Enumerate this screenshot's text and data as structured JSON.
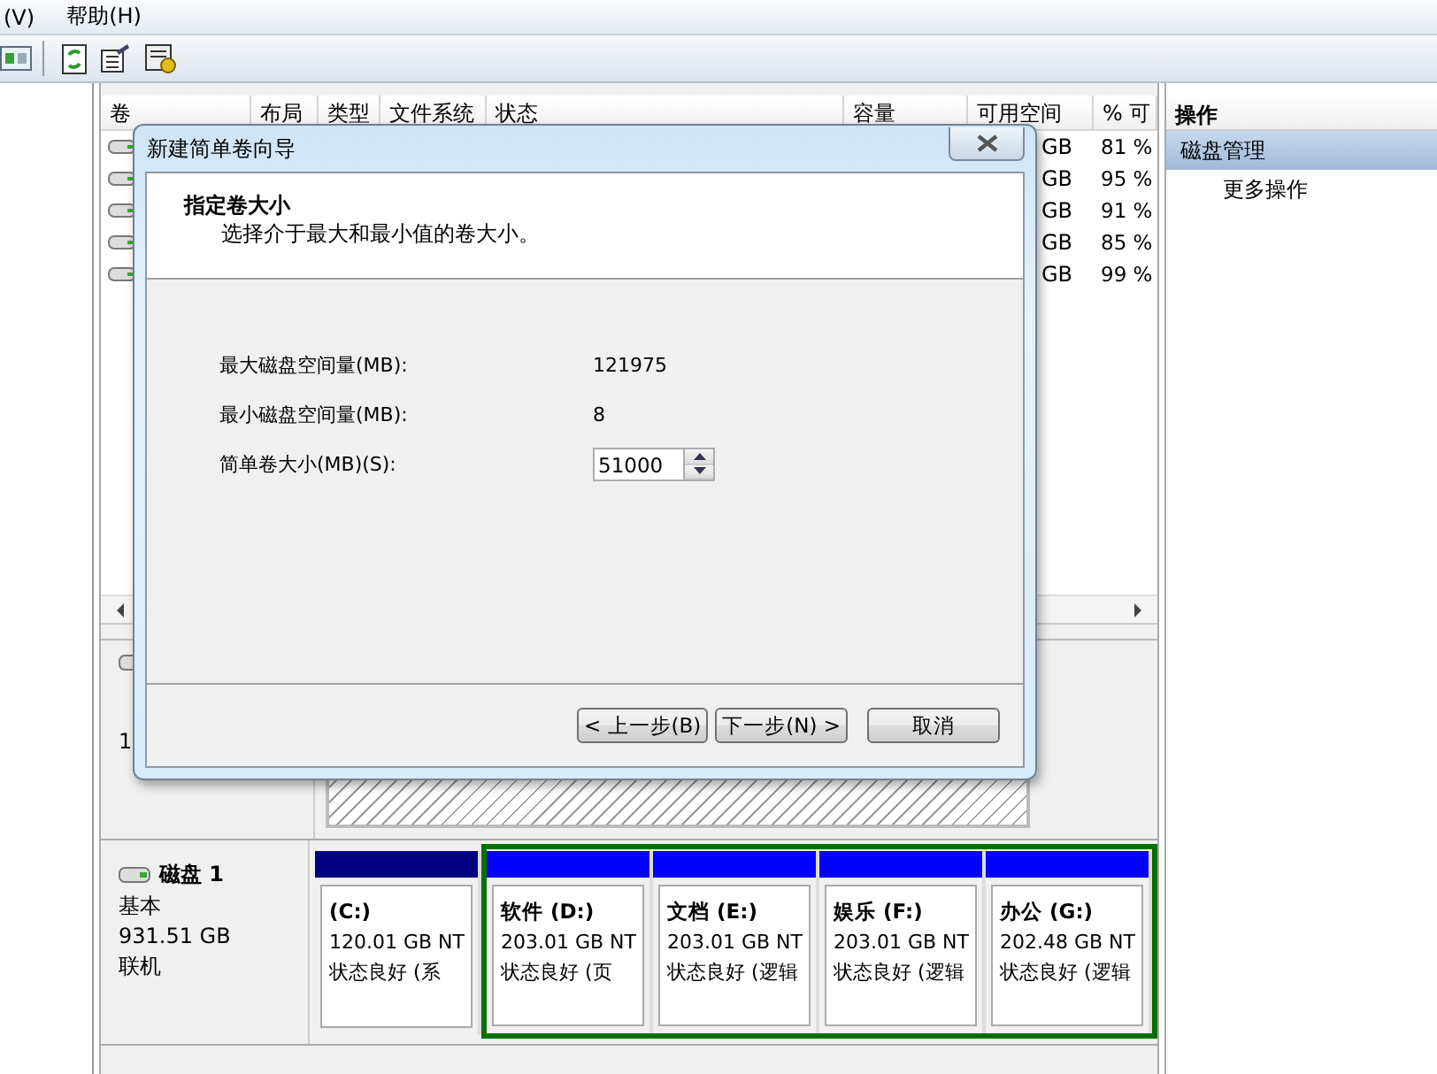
{
  "menu": [
    {
      "label": "(V)"
    },
    {
      "label": "帮助(H)"
    }
  ],
  "volume_table": {
    "columns": [
      "卷",
      "布局",
      "类型",
      "文件系统",
      "状态",
      "容量",
      "可用空间",
      "% 可"
    ],
    "rows": [
      {
        "free": "GB",
        "percent": "81 %"
      },
      {
        "free": "GB",
        "percent": "95 %"
      },
      {
        "free": "GB",
        "percent": "91 %"
      },
      {
        "free": "GB",
        "percent": "85 %"
      },
      {
        "free": "GB",
        "percent": "99 %"
      }
    ]
  },
  "disk0": {
    "lines": [
      "1"
    ]
  },
  "disk1": {
    "name": "磁盘 1",
    "type": "基本",
    "size": "931.51 GB",
    "status": "联机",
    "primary": [
      {
        "name": "(C:)",
        "size": "120.01 GB NT",
        "status": "状态良好 (系",
        "color": "#000080"
      }
    ],
    "extended": {
      "partitions": [
        {
          "name": "软件 (D:)",
          "size": "203.01 GB NT",
          "status": "状态良好 (页",
          "color": "#0000ff"
        },
        {
          "name": "文档 (E:)",
          "size": "203.01 GB NT",
          "status": "状态良好 (逻辑",
          "color": "#0000ff"
        },
        {
          "name": "娱乐 (F:)",
          "size": "203.01 GB NT",
          "status": "状态良好 (逻辑",
          "color": "#0000ff"
        },
        {
          "name": "办公 (G:)",
          "size": "202.48 GB NT",
          "status": "状态良好 (逻辑",
          "color": "#0000ff"
        }
      ]
    }
  },
  "actions": {
    "title": "操作",
    "items": [
      {
        "label": "磁盘管理",
        "kind": "section",
        "selected": true
      },
      {
        "label": "更多操作",
        "kind": "sub",
        "selected": false
      }
    ]
  },
  "dialog": {
    "title": "新建简单卷向导",
    "heading": "指定卷大小",
    "subtitle": "选择介于最大和最小值的卷大小。",
    "fields": [
      {
        "label": "最大磁盘空间量(MB):",
        "kind": "text",
        "value": "121975"
      },
      {
        "label": "最小磁盘空间量(MB):",
        "kind": "text",
        "value": "8"
      },
      {
        "label": "简单卷大小(MB)(S):",
        "kind": "spin",
        "value": "51000"
      }
    ],
    "buttons": [
      {
        "label": "< 上一步(B)"
      },
      {
        "label": "下一步(N) >"
      },
      {
        "label": "取消"
      }
    ]
  }
}
